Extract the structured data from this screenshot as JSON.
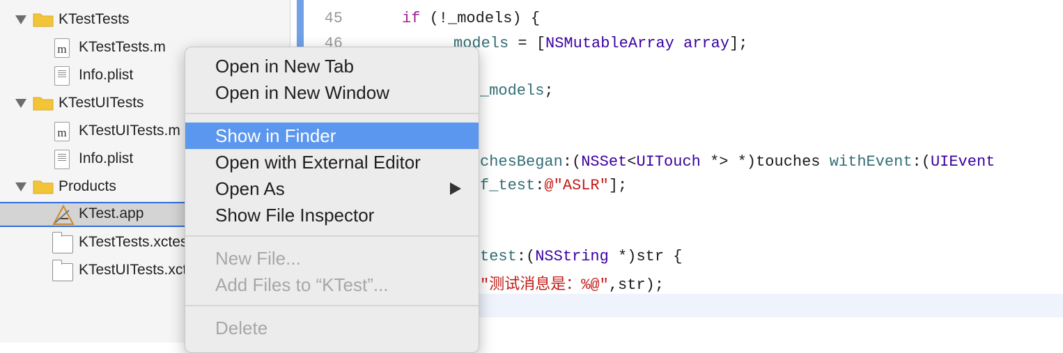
{
  "navigator": {
    "groups": [
      {
        "name": "KTestTests",
        "files": [
          {
            "name": "KTestTests.m",
            "icon": "objc-file-icon"
          },
          {
            "name": "Info.plist",
            "icon": "plist-file-icon"
          }
        ]
      },
      {
        "name": "KTestUITests",
        "files": [
          {
            "name": "KTestUITests.m",
            "icon": "objc-file-icon"
          },
          {
            "name": "Info.plist",
            "icon": "plist-file-icon"
          }
        ]
      },
      {
        "name": "Products",
        "files": [
          {
            "name": "KTest.app",
            "icon": "app-icon",
            "selected": true
          },
          {
            "name": "KTestTests.xctest",
            "icon": "bundle-icon"
          },
          {
            "name": "KTestUITests.xctest",
            "icon": "bundle-icon"
          }
        ]
      }
    ]
  },
  "editor": {
    "line_numbers": [
      "45",
      "46"
    ],
    "line45": {
      "kw": "if",
      "rest": " (!_models) {"
    },
    "line46": {
      "var": "models",
      "eq": " = [",
      "type": "NSMutableArray",
      "sp": " ",
      "method": "array",
      "end": "];"
    },
    "line_return": {
      "var": "_models",
      "end": ";"
    },
    "line_touches": {
      "fn1": "chesBegan",
      "p1": ":(",
      "type1": "NSSet",
      "p2": "<",
      "type2": "UITouch",
      "p3": " *> *)touches ",
      "fn2": "withEvent",
      "p4": ":(",
      "type3": "UIEvent"
    },
    "line_call": {
      "fn": "f_test",
      "p1": ":",
      "str": "@\"ASLR\"",
      "end": "];"
    },
    "line_decl": {
      "fn": "test",
      "p1": ":(",
      "type": "NSString",
      "end": " *)str {"
    },
    "line_log": {
      "str": "\"测试消息是：%@\"",
      "end": ",str);"
    }
  },
  "context_menu": {
    "open_new_tab": "Open in New Tab",
    "open_new_window": "Open in New Window",
    "show_in_finder": "Show in Finder",
    "open_external_editor": "Open with External Editor",
    "open_as": "Open As",
    "show_file_inspector": "Show File Inspector",
    "new_file": "New File...",
    "add_files": "Add Files to “KTest”...",
    "delete": "Delete"
  },
  "colors": {
    "selection": "#5b96ef",
    "keyword": "#9b2393",
    "type": "#3900a0",
    "string": "#c41a16"
  }
}
